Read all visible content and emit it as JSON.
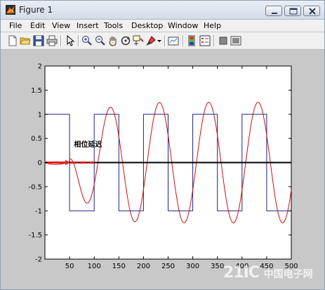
{
  "window": {
    "title": "Figure 1",
    "controls": {
      "minimize": "minimize",
      "maximize": "maximize",
      "close": "close"
    }
  },
  "menu": [
    "File",
    "Edit",
    "View",
    "Insert",
    "Tools",
    "Desktop",
    "Window",
    "Help"
  ],
  "toolbar": {
    "icons": [
      "new-figure-icon",
      "open-file-icon",
      "save-icon",
      "print-icon",
      "edit-plot-arrow-icon",
      "zoom-in-icon",
      "zoom-out-icon",
      "pan-hand-icon",
      "rotate-3d-icon",
      "data-cursor-icon",
      "brush-icon",
      "brush-dropdown-icon",
      "link-plot-icon",
      "colorbar-icon",
      "legend-icon",
      "hide-plot-tools-icon",
      "show-plot-tools-icon"
    ]
  },
  "chart_data": {
    "type": "line",
    "title": "",
    "xlabel": "",
    "ylabel": "",
    "xlim": [
      0,
      500
    ],
    "ylim": [
      -2,
      2
    ],
    "x_ticks": [
      "50",
      "100",
      "150",
      "200",
      "250",
      "300",
      "350",
      "400",
      "450",
      "500"
    ],
    "y_ticks": [
      "2",
      "1.5",
      "1",
      "0.5",
      "0",
      "-0.5",
      "-1",
      "-1.5",
      "-2"
    ],
    "grid": false,
    "series": [
      {
        "kind": "square_wave",
        "color": "#1a237e",
        "amplitude": 1,
        "period": 100,
        "phase_start": 0,
        "segments": [
          [
            0,
            50,
            1
          ],
          [
            50,
            100,
            -1
          ],
          [
            100,
            150,
            1
          ],
          [
            150,
            200,
            -1
          ],
          [
            200,
            250,
            1
          ],
          [
            250,
            300,
            -1
          ],
          [
            300,
            350,
            1
          ],
          [
            350,
            400,
            -1
          ],
          [
            400,
            450,
            1
          ],
          [
            450,
            500,
            -1
          ]
        ]
      },
      {
        "kind": "damped_response",
        "color": "#cc1111",
        "period": 100,
        "peak": 1.25,
        "phase_lag": 15
      },
      {
        "kind": "baseline",
        "color": "#000000",
        "y": 0
      }
    ],
    "annotation": {
      "text": "相位延迟",
      "color": "#000000"
    }
  },
  "watermark": {
    "text": "21IC",
    "sub": "中国电子网"
  }
}
